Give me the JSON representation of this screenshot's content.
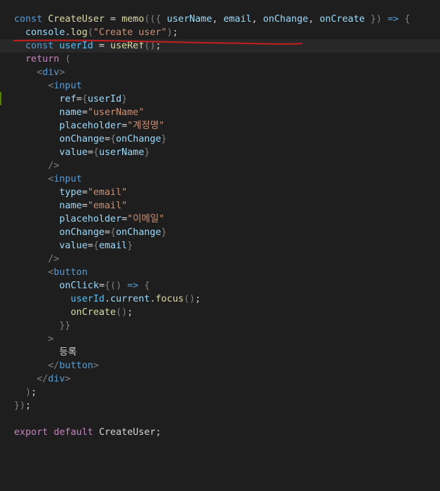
{
  "editor": {
    "theme": "dark",
    "colors": {
      "background": "#1e1e1e",
      "keyword": "#569cd6",
      "identifier": "#9cdcfe",
      "function": "#dcdcaa",
      "string": "#ce9178",
      "annotation_stroke": "#c81e1e",
      "gutter_modified": "#587c0c"
    },
    "lines": [
      [
        [
          "kw",
          "const"
        ],
        [
          "txt",
          " "
        ],
        [
          "fn",
          "CreateUser"
        ],
        [
          "txt",
          " = "
        ],
        [
          "fn",
          "memo"
        ],
        [
          "brk",
          "(({ "
        ],
        [
          "id",
          "userName"
        ],
        [
          "txt",
          ", "
        ],
        [
          "id",
          "email"
        ],
        [
          "txt",
          ", "
        ],
        [
          "id",
          "onChange"
        ],
        [
          "txt",
          ", "
        ],
        [
          "id",
          "onCreate"
        ],
        [
          "brk",
          " })"
        ],
        [
          "kw",
          " =>"
        ],
        [
          "txt",
          " "
        ],
        [
          "brk",
          "{"
        ]
      ],
      [
        [
          "txt",
          "  "
        ],
        [
          "id",
          "console"
        ],
        [
          "txt",
          "."
        ],
        [
          "fn",
          "log"
        ],
        [
          "brk",
          "("
        ],
        [
          "str",
          "\"Create user\""
        ],
        [
          "brk",
          ")"
        ],
        [
          "txt",
          ";"
        ]
      ],
      [
        [
          "txt",
          "  "
        ],
        [
          "kw",
          "const"
        ],
        [
          "txt",
          " "
        ],
        [
          "const",
          "userId"
        ],
        [
          "txt",
          " = "
        ],
        [
          "fn",
          "useRef"
        ],
        [
          "brk",
          "()"
        ],
        [
          "txt",
          ";"
        ]
      ],
      [
        [
          "txt",
          "  "
        ],
        [
          "ctl",
          "return"
        ],
        [
          "txt",
          " "
        ],
        [
          "brk",
          "("
        ]
      ],
      [
        [
          "txt",
          "    "
        ],
        [
          "brk",
          "<"
        ],
        [
          "tag",
          "div"
        ],
        [
          "brk",
          ">"
        ]
      ],
      [
        [
          "txt",
          "      "
        ],
        [
          "brk",
          "<"
        ],
        [
          "tag",
          "input"
        ]
      ],
      [
        [
          "txt",
          "        "
        ],
        [
          "id",
          "ref"
        ],
        [
          "txt",
          "="
        ],
        [
          "brk",
          "{"
        ],
        [
          "id",
          "userId"
        ],
        [
          "brk",
          "}"
        ]
      ],
      [
        [
          "txt",
          "        "
        ],
        [
          "id",
          "name"
        ],
        [
          "txt",
          "="
        ],
        [
          "str",
          "\"userName\""
        ]
      ],
      [
        [
          "txt",
          "        "
        ],
        [
          "id",
          "placeholder"
        ],
        [
          "txt",
          "="
        ],
        [
          "str",
          "\"계정명\""
        ]
      ],
      [
        [
          "txt",
          "        "
        ],
        [
          "id",
          "onChange"
        ],
        [
          "txt",
          "="
        ],
        [
          "brk",
          "{"
        ],
        [
          "id",
          "onChange"
        ],
        [
          "brk",
          "}"
        ]
      ],
      [
        [
          "txt",
          "        "
        ],
        [
          "id",
          "value"
        ],
        [
          "txt",
          "="
        ],
        [
          "brk",
          "{"
        ],
        [
          "id",
          "userName"
        ],
        [
          "brk",
          "}"
        ]
      ],
      [
        [
          "txt",
          "      "
        ],
        [
          "brk",
          "/>"
        ]
      ],
      [
        [
          "txt",
          "      "
        ],
        [
          "brk",
          "<"
        ],
        [
          "tag",
          "input"
        ]
      ],
      [
        [
          "txt",
          "        "
        ],
        [
          "id",
          "type"
        ],
        [
          "txt",
          "="
        ],
        [
          "str",
          "\"email\""
        ]
      ],
      [
        [
          "txt",
          "        "
        ],
        [
          "id",
          "name"
        ],
        [
          "txt",
          "="
        ],
        [
          "str",
          "\"email\""
        ]
      ],
      [
        [
          "txt",
          "        "
        ],
        [
          "id",
          "placeholder"
        ],
        [
          "txt",
          "="
        ],
        [
          "str",
          "\"이메일\""
        ]
      ],
      [
        [
          "txt",
          "        "
        ],
        [
          "id",
          "onChange"
        ],
        [
          "txt",
          "="
        ],
        [
          "brk",
          "{"
        ],
        [
          "id",
          "onChange"
        ],
        [
          "brk",
          "}"
        ]
      ],
      [
        [
          "txt",
          "        "
        ],
        [
          "id",
          "value"
        ],
        [
          "txt",
          "="
        ],
        [
          "brk",
          "{"
        ],
        [
          "id",
          "email"
        ],
        [
          "brk",
          "}"
        ]
      ],
      [
        [
          "txt",
          "      "
        ],
        [
          "brk",
          "/>"
        ]
      ],
      [
        [
          "txt",
          "      "
        ],
        [
          "brk",
          "<"
        ],
        [
          "tag",
          "button"
        ]
      ],
      [
        [
          "txt",
          "        "
        ],
        [
          "id",
          "onClick"
        ],
        [
          "txt",
          "="
        ],
        [
          "brk",
          "{()"
        ],
        [
          "kw",
          " =>"
        ],
        [
          "txt",
          " "
        ],
        [
          "brk",
          "{"
        ]
      ],
      [
        [
          "txt",
          "          "
        ],
        [
          "const",
          "userId"
        ],
        [
          "txt",
          "."
        ],
        [
          "id",
          "current"
        ],
        [
          "txt",
          "."
        ],
        [
          "fn",
          "focus"
        ],
        [
          "brk",
          "()"
        ],
        [
          "txt",
          ";"
        ]
      ],
      [
        [
          "txt",
          "          "
        ],
        [
          "fn",
          "onCreate"
        ],
        [
          "brk",
          "()"
        ],
        [
          "txt",
          ";"
        ]
      ],
      [
        [
          "txt",
          "        "
        ],
        [
          "brk",
          "}}"
        ]
      ],
      [
        [
          "txt",
          "      "
        ],
        [
          "brk",
          ">"
        ]
      ],
      [
        [
          "txt",
          "        "
        ],
        [
          "txt",
          "등록"
        ]
      ],
      [
        [
          "txt",
          "      "
        ],
        [
          "brk",
          "</"
        ],
        [
          "tag",
          "button"
        ],
        [
          "brk",
          ">"
        ]
      ],
      [
        [
          "txt",
          "    "
        ],
        [
          "brk",
          "</"
        ],
        [
          "tag",
          "div"
        ],
        [
          "brk",
          ">"
        ]
      ],
      [
        [
          "txt",
          "  "
        ],
        [
          "brk",
          ")"
        ],
        [
          "txt",
          ";"
        ]
      ],
      [
        [
          "brk",
          "})"
        ],
        [
          "txt",
          ";"
        ]
      ],
      [],
      [
        [
          "ctl",
          "export"
        ],
        [
          "txt",
          " "
        ],
        [
          "ctl",
          "default"
        ],
        [
          "txt",
          " "
        ],
        [
          "txt",
          "CreateUser"
        ],
        [
          "txt",
          ";"
        ]
      ]
    ],
    "annotation": "red-underline"
  }
}
